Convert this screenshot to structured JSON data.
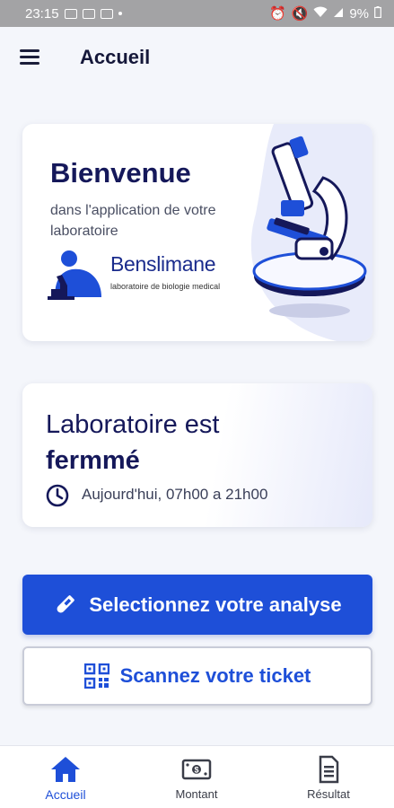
{
  "status_bar": {
    "time": "23:15",
    "battery": "9%"
  },
  "app_bar": {
    "title": "Accueil",
    "menu_icon": "hamburger-menu-icon"
  },
  "welcome": {
    "title": "Bienvenue",
    "subtitle": "dans l'application de votre laboratoire",
    "logo_name_a": "Ben",
    "logo_name_b": "slimane",
    "logo_tagline": "laboratoire de biologie medical",
    "illustration": "microscope"
  },
  "lab_status": {
    "line1": "Laboratoire est",
    "line2": "fermmé",
    "hours": "Aujourd'hui, 07h00 a 21h00",
    "icon": "clock-icon"
  },
  "actions": {
    "select_analysis": "Selectionnez votre analyse",
    "scan_ticket": "Scannez votre ticket"
  },
  "bottom_nav": [
    {
      "label": "Accueil",
      "icon": "home-icon",
      "active": true
    },
    {
      "label": "Montant",
      "icon": "money-icon",
      "active": false
    },
    {
      "label": "Résultat",
      "icon": "document-icon",
      "active": false
    }
  ],
  "colors": {
    "primary": "#1e4fd8",
    "navy": "#15185a",
    "background": "#f4f6fb"
  }
}
